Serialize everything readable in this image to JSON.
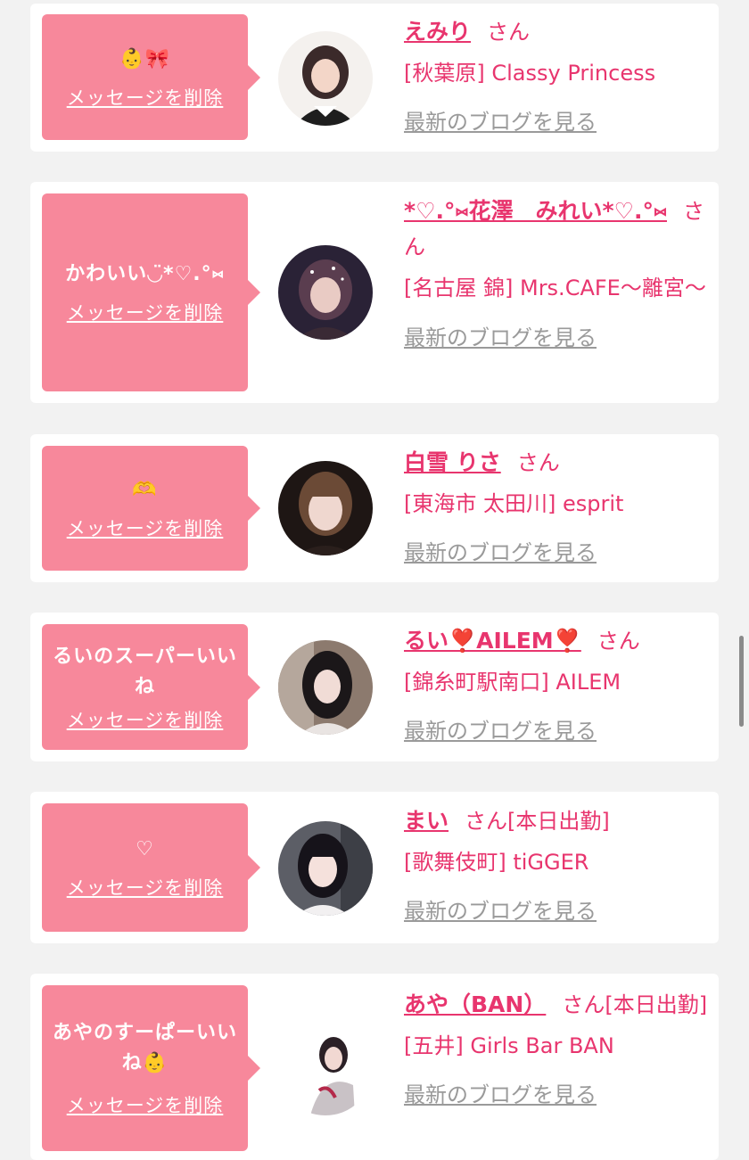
{
  "delete_label": "メッセージを削除",
  "san_label": "さん",
  "blog_label": "最新のブログを見る",
  "colors": {
    "bubble": "#f7889b",
    "accent": "#e8356e",
    "muted": "#9a9a9a",
    "page_bg": "#f2f2f2"
  },
  "cards": [
    {
      "message": "👶🎀",
      "name": "えみり",
      "today": "",
      "shop": "[秋葉原] Classy Princess"
    },
    {
      "message": "かわいい◡̈*♡.°⑅",
      "name": "*♡.°⑅花澤　みれい*♡.°⑅",
      "today": "",
      "shop": "[名古屋 錦] Mrs.CAFE〜離宮〜"
    },
    {
      "message": "🫶",
      "name": "白雪 りさ",
      "today": "",
      "shop": "[東海市 太田川] esprit"
    },
    {
      "message": "るいのスーパーいいね",
      "name": "るい❣️AILEM❣️",
      "today": "",
      "shop": "[錦糸町駅南口] AILEM"
    },
    {
      "message": "♡",
      "name": "まい",
      "today": "[本日出勤]",
      "shop": "[歌舞伎町] tiGGER"
    },
    {
      "message": "あやのすーぱーいいね👶",
      "name": "あや（BAN）",
      "today": "[本日出勤]",
      "shop": "[五井] Girls Bar BAN"
    }
  ]
}
